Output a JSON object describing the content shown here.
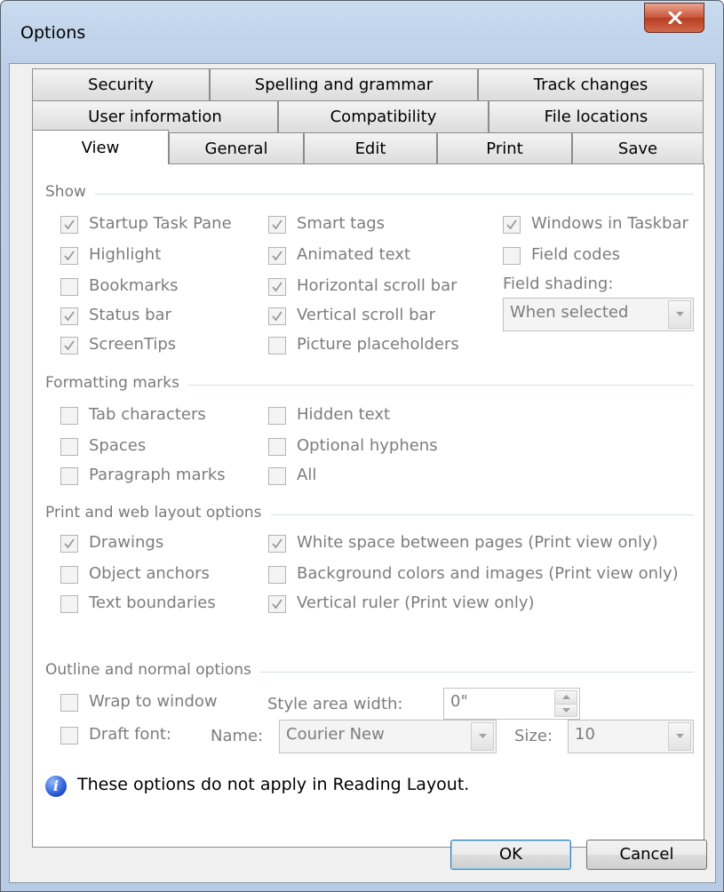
{
  "window": {
    "title": "Options"
  },
  "tabs": {
    "row1": [
      "Security",
      "Spelling and grammar",
      "Track changes"
    ],
    "row2": [
      "User information",
      "Compatibility",
      "File locations"
    ],
    "row3": [
      "View",
      "General",
      "Edit",
      "Print",
      "Save"
    ],
    "selected": "View"
  },
  "show": {
    "label": "Show",
    "col1": [
      {
        "label": "Startup Task Pane",
        "checked": true
      },
      {
        "label": "Highlight",
        "checked": true
      },
      {
        "label": "Bookmarks",
        "checked": false
      },
      {
        "label": "Status bar",
        "checked": true
      },
      {
        "label": "ScreenTips",
        "checked": true
      }
    ],
    "col2": [
      {
        "label": "Smart tags",
        "checked": true
      },
      {
        "label": "Animated text",
        "checked": true
      },
      {
        "label": "Horizontal scroll bar",
        "checked": true
      },
      {
        "label": "Vertical scroll bar",
        "checked": true
      },
      {
        "label": "Picture placeholders",
        "checked": false
      }
    ],
    "col3": [
      {
        "label": "Windows in Taskbar",
        "checked": true
      },
      {
        "label": "Field codes",
        "checked": false
      }
    ],
    "field_shading_label": "Field shading:",
    "field_shading_value": "When selected"
  },
  "formatting": {
    "label": "Formatting marks",
    "col1": [
      {
        "label": "Tab characters",
        "checked": false
      },
      {
        "label": "Spaces",
        "checked": false
      },
      {
        "label": "Paragraph marks",
        "checked": false
      }
    ],
    "col2": [
      {
        "label": "Hidden text",
        "checked": false
      },
      {
        "label": "Optional hyphens",
        "checked": false
      },
      {
        "label": "All",
        "checked": false
      }
    ]
  },
  "printweb": {
    "label": "Print and web layout options",
    "col1": [
      {
        "label": "Drawings",
        "checked": true
      },
      {
        "label": "Object anchors",
        "checked": false
      },
      {
        "label": "Text boundaries",
        "checked": false
      }
    ],
    "col2": [
      {
        "label": "White space between pages (Print view only)",
        "checked": true
      },
      {
        "label": "Background colors and images (Print view only)",
        "checked": false
      },
      {
        "label": "Vertical ruler (Print view only)",
        "checked": true
      }
    ]
  },
  "outline": {
    "label": "Outline and normal options",
    "wrap": {
      "label": "Wrap to window",
      "checked": false
    },
    "style_area_label": "Style area width:",
    "style_area_value": "0\"",
    "draft": {
      "label": "Draft font:",
      "checked": false
    },
    "name_label": "Name:",
    "name_value": "Courier New",
    "size_label": "Size:",
    "size_value": "10"
  },
  "info": {
    "icon": "info-icon",
    "text": "These options do not apply in Reading Layout."
  },
  "buttons": {
    "ok": "OK",
    "cancel": "Cancel"
  }
}
